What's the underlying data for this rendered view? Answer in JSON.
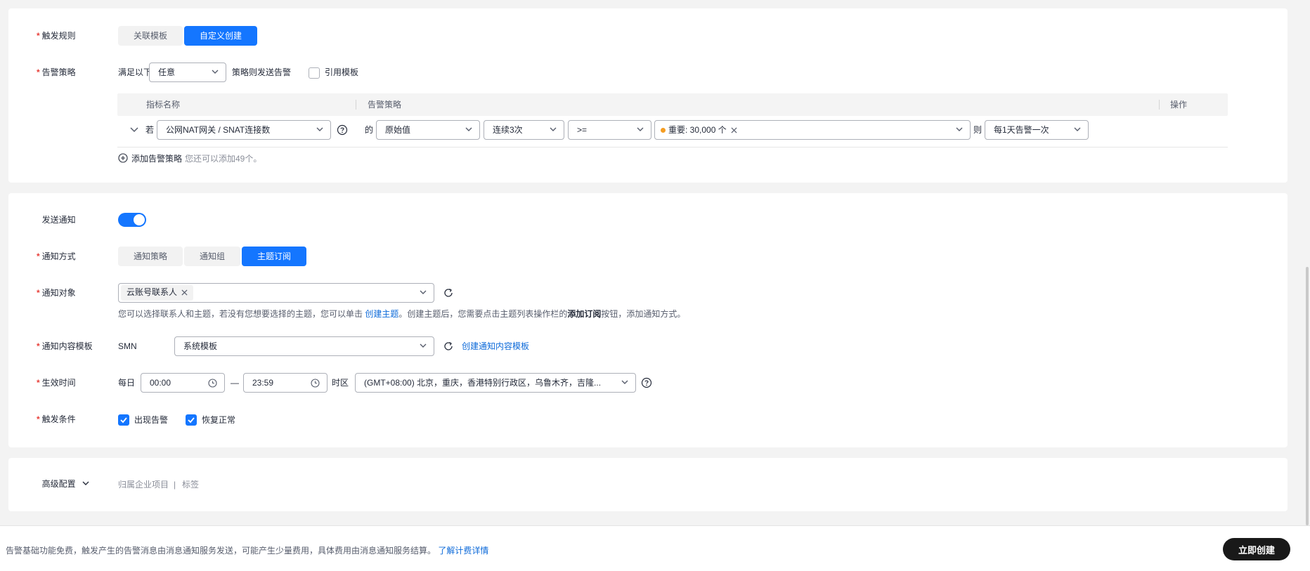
{
  "trigger_rule": {
    "label": "触发规则",
    "options": [
      "关联模板",
      "自定义创建"
    ],
    "selected": "自定义创建"
  },
  "alarm_policy": {
    "label": "告警策略",
    "prefix": "满足以下",
    "match_value": "任意",
    "suffix": "策略则发送告警",
    "use_template_label": "引用模板",
    "use_template_checked": false,
    "table": {
      "headers": [
        "指标名称",
        "告警策略",
        "操作"
      ],
      "row": {
        "if_label": "若",
        "metric": "公网NAT网关 / SNAT连接数",
        "of_label": "的",
        "stat": "原始值",
        "period": "连续3次",
        "operator": ">=",
        "threshold_tag": "重要: 30,000 个",
        "threshold_dot_color": "#f59d22",
        "then_label": "则",
        "frequency": "每1天告警一次"
      }
    },
    "add_policy_label": "添加告警策略",
    "add_policy_hint": "您还可以添加49个。"
  },
  "notification": {
    "send_label": "发送通知",
    "send_enabled": true,
    "method": {
      "label": "通知方式",
      "options": [
        "通知策略",
        "通知组",
        "主题订阅"
      ],
      "selected": "主题订阅"
    },
    "target": {
      "label": "通知对象",
      "tag": "云账号联系人",
      "help_part1": "您可以选择联系人和主题，若没有您想要选择的主题，您可以单击",
      "help_link": "创建主题",
      "help_part2": "。创建主题后，您需要点击主题列表操作栏的",
      "help_bold": "添加订阅",
      "help_part3": "按钮，添加通知方式。"
    },
    "template": {
      "label": "通知内容模板",
      "channel": "SMN",
      "value": "系统模板",
      "create_link": "创建通知内容模板"
    },
    "effective_time": {
      "label": "生效时间",
      "daily_label": "每日",
      "start": "00:00",
      "separator": "—",
      "end": "23:59",
      "tz_label": "时区",
      "timezone": "(GMT+08:00) 北京，重庆，香港特别行政区，乌鲁木齐，吉隆..."
    },
    "trigger_condition": {
      "label": "触发条件",
      "options": [
        {
          "label": "出现告警",
          "checked": true
        },
        {
          "label": "恢复正常",
          "checked": true
        }
      ]
    }
  },
  "advanced": {
    "label": "高级配置",
    "items": [
      "归属企业项目",
      "|",
      "标签"
    ]
  },
  "footer": {
    "notice": "告警基础功能免费，触发产生的告警消息由消息通知服务发送，可能产生少量费用，具体费用由消息通知服务结算。",
    "link": "了解计费详情",
    "submit_label": "立即创建"
  },
  "colors": {
    "primary": "#1476ff",
    "required": "#e8413b",
    "link": "#0d6ad9",
    "submit": "#191919"
  }
}
